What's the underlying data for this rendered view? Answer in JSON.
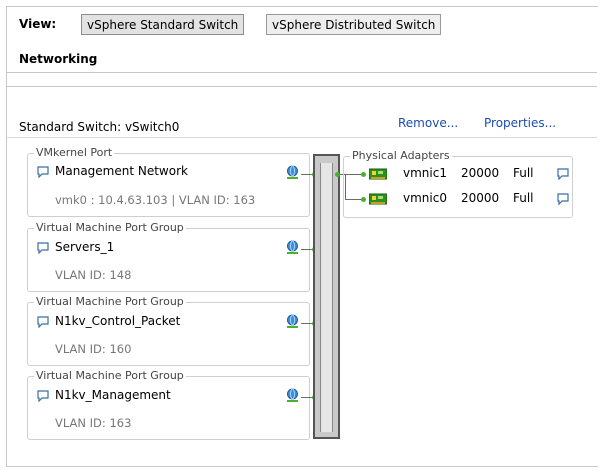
{
  "view": {
    "label": "View:",
    "tabs": [
      {
        "label": "vSphere Standard Switch",
        "active": true
      },
      {
        "label": "vSphere Distributed Switch",
        "active": false
      }
    ]
  },
  "section_title": "Networking",
  "switch": {
    "title": "Standard Switch: vSwitch0",
    "remove_label": "Remove...",
    "properties_label": "Properties..."
  },
  "port_groups": [
    {
      "type": "VMkernel Port",
      "name": "Management Network",
      "detail": "vmk0 : 10.4.63.103 | VLAN ID: 163"
    },
    {
      "type": "Virtual Machine Port Group",
      "name": "Servers_1",
      "detail": "VLAN ID: 148"
    },
    {
      "type": "Virtual Machine Port Group",
      "name": "N1kv_Control_Packet",
      "detail": "VLAN ID: 160"
    },
    {
      "type": "Virtual Machine Port Group",
      "name": "N1kv_Management",
      "detail": "VLAN ID: 163"
    }
  ],
  "physical_adapters": {
    "label": "Physical Adapters",
    "items": [
      {
        "name": "vmnic1",
        "speed": "20000",
        "duplex": "Full"
      },
      {
        "name": "vmnic0",
        "speed": "20000",
        "duplex": "Full"
      }
    ]
  },
  "colors": {
    "link": "#1a4db3",
    "status_dot": "#48b22a",
    "switch_bar": "#c9c9c9"
  }
}
